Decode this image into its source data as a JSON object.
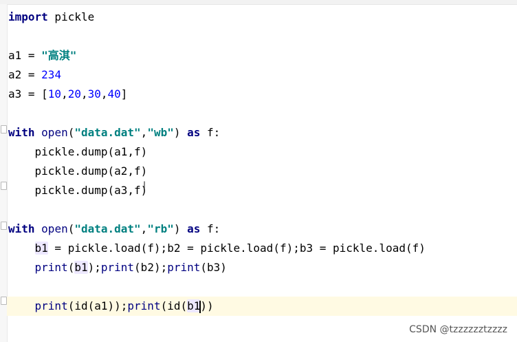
{
  "editor": {
    "lines": {
      "l1": {
        "kw": "import",
        "rest": " pickle"
      },
      "l3": {
        "pre": "a1 = ",
        "str": "\"高淇\""
      },
      "l4": {
        "pre": "a2 = ",
        "num": "234"
      },
      "l5": {
        "pre": "a3 = [",
        "n1": "10",
        "c1": ",",
        "n2": "20",
        "c2": ",",
        "n3": "30",
        "c3": ",",
        "n4": "40",
        "post": "]"
      },
      "l7": {
        "kw1": "with",
        "sp1": " ",
        "bi": "open",
        "p1": "(",
        "s1": "\"data.dat\"",
        "comma": ",",
        "s2": "\"wb\"",
        "p2": ") ",
        "kw2": "as",
        "post": " f:"
      },
      "l8": "    pickle.dump(a1,f)",
      "l9": "    pickle.dump(a2,f)",
      "l10": "    pickle.dump(a3,f)",
      "l12": {
        "kw1": "with",
        "sp1": " ",
        "bi": "open",
        "p1": "(",
        "s1": "\"data.dat\"",
        "comma": ",",
        "s2": "\"rb\"",
        "p2": ") ",
        "kw2": "as",
        "post": " f:"
      },
      "l13": {
        "indent": "    ",
        "b1": "b1",
        "rest": " = pickle.load(f);b2 = pickle.load(f);b3 = pickle.load(f)"
      },
      "l14": {
        "indent": "    ",
        "pr1": "print",
        "o1": "(",
        "b1": "b1",
        "mid1": ");",
        "pr2": "print",
        "mid2": "(b2);",
        "pr3": "print",
        "mid3": "(b3)"
      },
      "l16": {
        "indent": "    ",
        "pr1": "print",
        "mid1": "(id(a1));",
        "pr2": "print",
        "mid2": "(id(",
        "b1": "b1",
        "post": "))"
      }
    }
  },
  "watermark": "CSDN @tzzzzzztzzzz"
}
